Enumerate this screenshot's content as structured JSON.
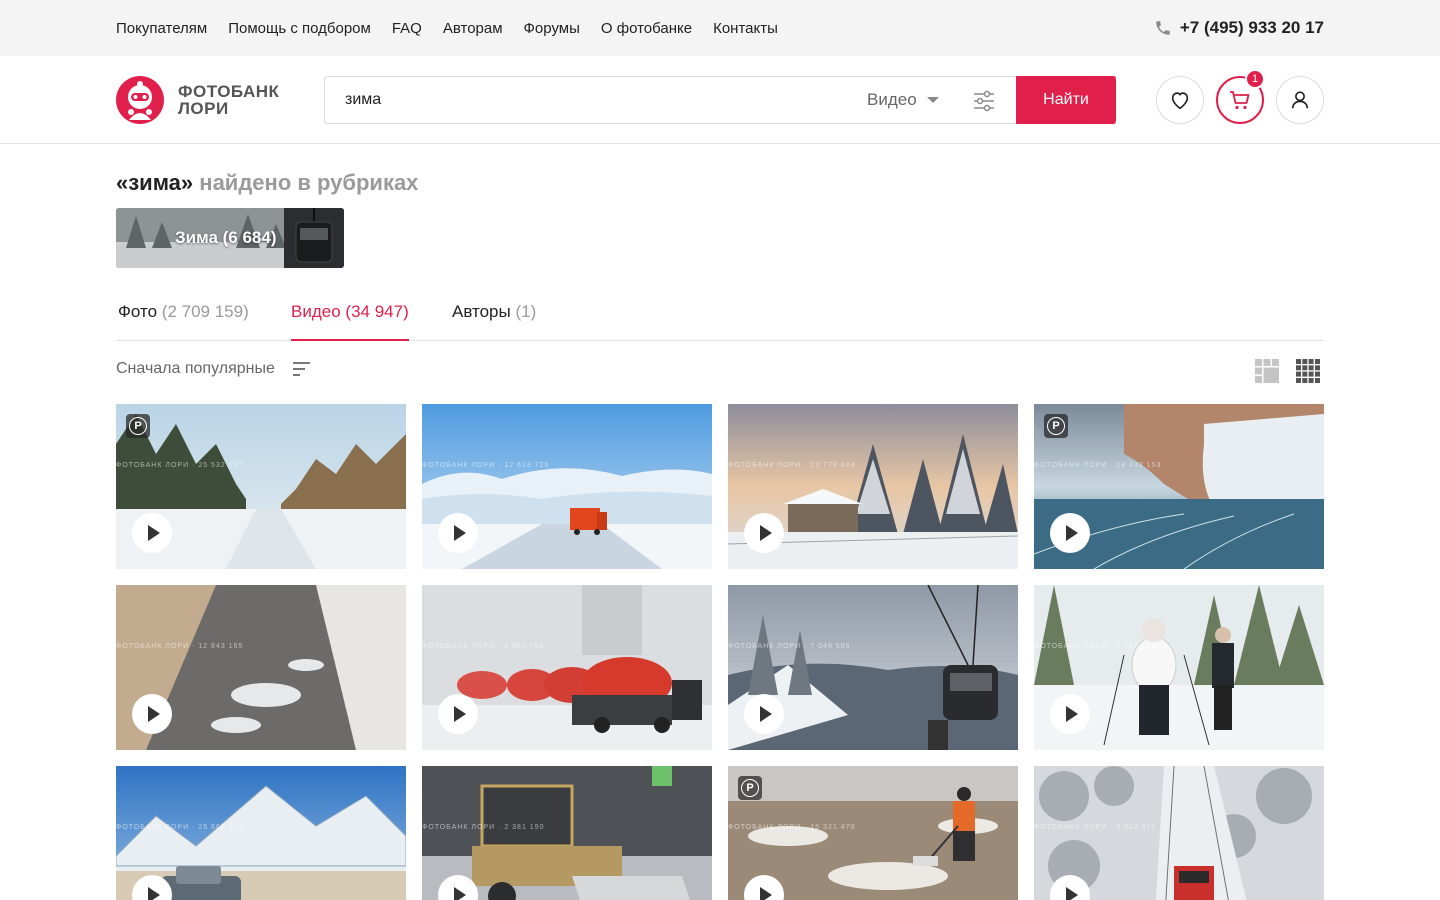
{
  "topnav": {
    "items": [
      "Покупателям",
      "Помощь с подбором",
      "FAQ",
      "Авторам",
      "Форумы",
      "О фотобанке",
      "Контакты"
    ],
    "phone": "+7 (495) 933 20 17"
  },
  "header": {
    "logo_line1": "ФОТОБАНК",
    "logo_line2": "ЛОРИ",
    "search_value": "зима",
    "type_select": "Видео",
    "find_label": "Найти",
    "cart_count": "1"
  },
  "results": {
    "query": "«зима»",
    "found_in": "найдено в рубриках",
    "rubric_label": "Зима (6 684)"
  },
  "tabs": [
    {
      "label": "Фото",
      "count": "(2 709 159)"
    },
    {
      "label": "Видео",
      "count": "(34 947)"
    },
    {
      "label": "Авторы",
      "count": "(1)"
    }
  ],
  "sort": {
    "label": "Сначала популярные"
  },
  "thumbnails": [
    {
      "scene": "snowy-forest-road",
      "r_mark": true,
      "watermark": "ФОТОБАНК ЛОРИ · 25 532 657"
    },
    {
      "scene": "orange-truck-winter-road",
      "r_mark": false,
      "watermark": "ФОТОБАНК ЛОРИ · 12 623 726"
    },
    {
      "scene": "village-house-snow-trees",
      "r_mark": false,
      "watermark": "ФОТОБАНК ЛОРИ · 23 778 404"
    },
    {
      "scene": "baikal-ice-cliff",
      "r_mark": true,
      "watermark": "ФОТОБАНК ЛОРИ · 28 432 153"
    },
    {
      "scene": "wet-road-snow-edges",
      "r_mark": false,
      "watermark": "ФОТОБАНК ЛОРИ · 12 843 165"
    },
    {
      "scene": "snow-removal-trucks",
      "r_mark": false,
      "watermark": "ФОТОБАНК ЛОРИ · 2 881 759"
    },
    {
      "scene": "cable-car-mountains",
      "r_mark": false,
      "watermark": "ФОТОБАНК ЛОРИ · 7 048 589"
    },
    {
      "scene": "cross-country-skiers",
      "r_mark": false,
      "watermark": "ФОТОБАНК ЛОРИ · 5 547 844"
    },
    {
      "scene": "volcanoes-pickup",
      "r_mark": false,
      "watermark": "ФОТОБАНК ЛОРИ · 25 665 403"
    },
    {
      "scene": "grader-snow-night",
      "r_mark": false,
      "watermark": "ФОТОБАНК ЛОРИ · 2 381 190"
    },
    {
      "scene": "worker-shoveling",
      "r_mark": true,
      "watermark": "ФОТОБАНК ЛОРИ · 15 321 470"
    },
    {
      "scene": "train-snowy-forest",
      "r_mark": false,
      "watermark": "ФОТОБАНК ЛОРИ · 4 682 311"
    }
  ],
  "colors": {
    "accent": "#e0204b",
    "topbar": "#f4f4f4"
  }
}
